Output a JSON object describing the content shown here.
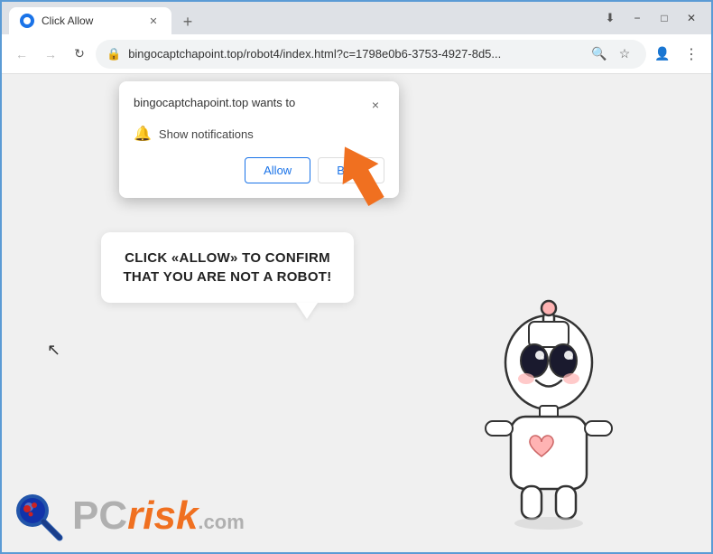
{
  "window": {
    "title": "Click Allow",
    "controls": {
      "minimize": "−",
      "maximize": "□",
      "close": "✕"
    }
  },
  "tab": {
    "title": "Click Allow",
    "close": "✕"
  },
  "new_tab_btn": "+",
  "nav": {
    "back": "←",
    "forward": "→",
    "refresh": "↻",
    "url": "bingocaptchapoint.top/robot4/index.html?c=1798e0b6-3753-4927-8d5...",
    "search_icon": "🔍",
    "star_icon": "☆",
    "profile_icon": "👤",
    "menu_icon": "⋮",
    "download_icon": "⬇"
  },
  "popup": {
    "site_text": "bingocaptchapoint.top wants to",
    "notification_label": "Show notifications",
    "close_btn": "×",
    "allow_btn": "Allow",
    "block_btn": "Block"
  },
  "captcha_message": "CLICK «ALLOW» TO CONFIRM THAT YOU ARE NOT A ROBOT!",
  "pcrisk": {
    "text_gray": "PC",
    "text_orange": "risk",
    "domain": ".com"
  },
  "colors": {
    "accent_blue": "#1a73e8",
    "orange": "#f07020",
    "background": "#f0f0f0",
    "popup_shadow": "rgba(0,0,0,0.25)"
  }
}
